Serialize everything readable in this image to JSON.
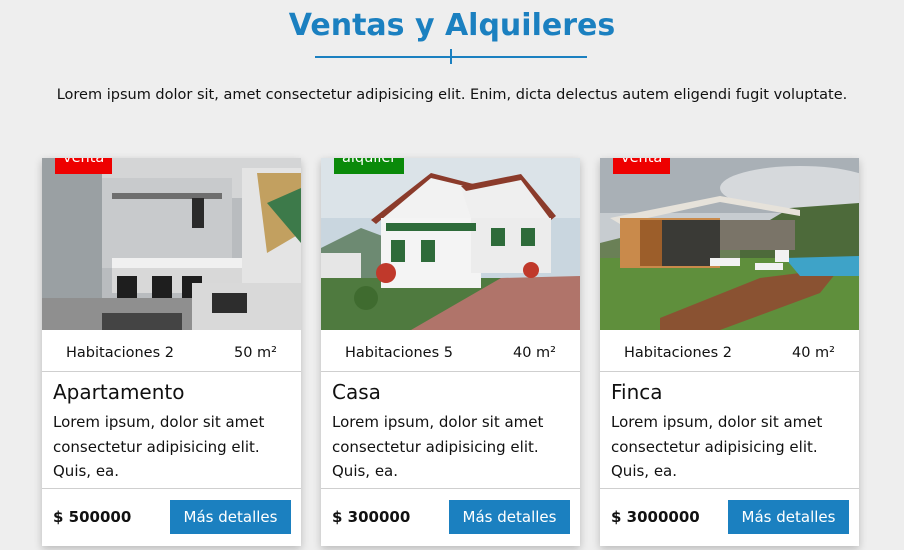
{
  "header": {
    "title": "Ventas y Alquileres",
    "intro": "Lorem ipsum dolor sit, amet consectetur adipisicing elit. Enim, dicta delectus autem eligendi fugit voluptate."
  },
  "colors": {
    "accent": "#1b80c0",
    "badge_venta": "#ee0000",
    "badge_alquiler": "#0a8a0a"
  },
  "cards": [
    {
      "badge": "venta",
      "rooms": "Habitaciones 2",
      "area": "50 m²",
      "name": "Apartamento",
      "description": "Lorem ipsum, dolor sit amet consectetur adipisicing elit. Quis, ea.",
      "price": "$ 500000",
      "button": "Más detalles"
    },
    {
      "badge": "alquiler",
      "rooms": "Habitaciones 5",
      "area": "40 m²",
      "name": "Casa",
      "description": "Lorem ipsum, dolor sit amet consectetur adipisicing elit. Quis, ea.",
      "price": "$ 300000",
      "button": "Más detalles"
    },
    {
      "badge": "venta",
      "rooms": "Habitaciones 2",
      "area": "40 m²",
      "name": "Finca",
      "description": "Lorem ipsum, dolor sit amet consectetur adipisicing elit. Quis, ea.",
      "price": "$ 3000000",
      "button": "Más detalles"
    }
  ]
}
